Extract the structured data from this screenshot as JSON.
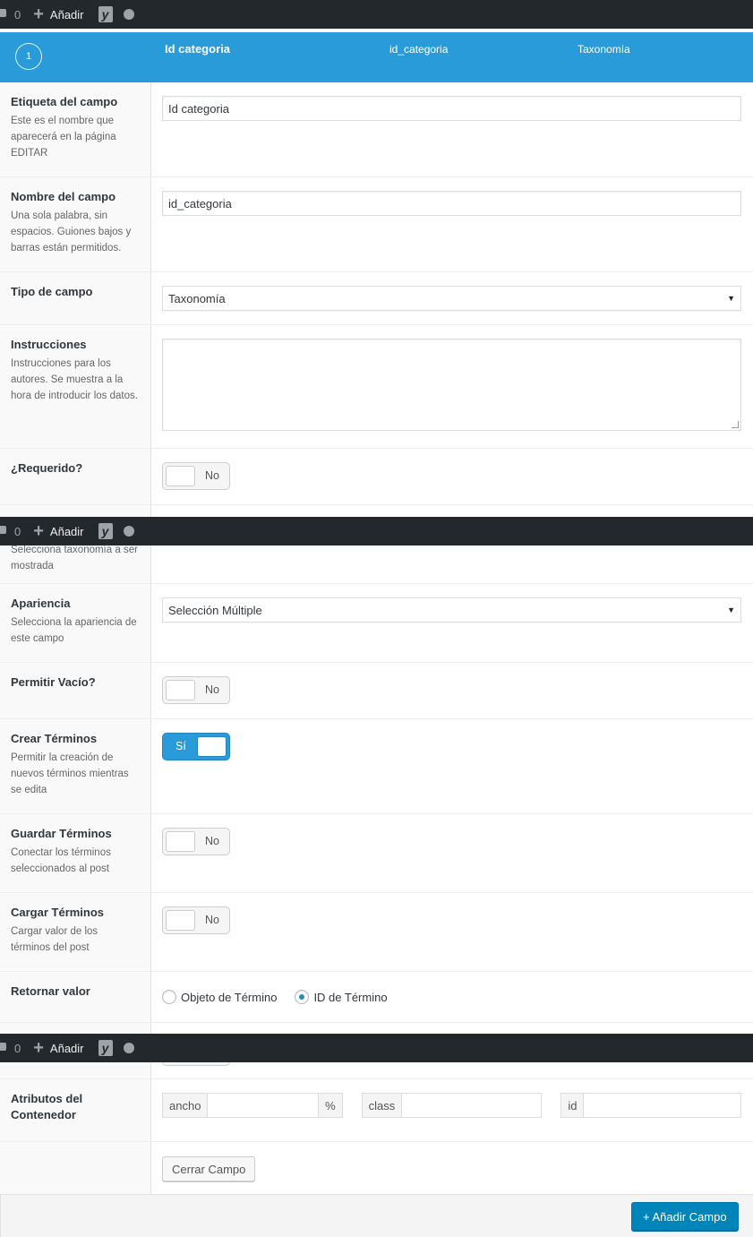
{
  "adminbar": {
    "comment_count": "0",
    "add_label": "Añadir",
    "seo_icon_letter": "y"
  },
  "field_header": {
    "order": "1",
    "label": "Id categoria",
    "name": "id_categoria",
    "type": "Taxonomía"
  },
  "fields": {
    "label": {
      "title": "Etiqueta del campo",
      "desc": "Este es el nombre que aparecerá en la página EDITAR",
      "value": "Id categoria"
    },
    "name": {
      "title": "Nombre del campo",
      "desc": "Una sola palabra, sin espacios. Guiones bajos y barras están permitidos.",
      "value": "id_categoria"
    },
    "type": {
      "title": "Tipo de campo",
      "value": "Taxonomía"
    },
    "instructions": {
      "title": "Instrucciones",
      "desc": "Instrucciones para los autores. Se muestra a la hora de introducir los datos.",
      "value": ""
    },
    "required": {
      "title": "¿Requerido?",
      "state": "No"
    },
    "taxonomy": {
      "desc": "Selecciona taxonomía a ser mostrada"
    },
    "appearance": {
      "title": "Apariencia",
      "desc": "Selecciona la apariencia de este campo",
      "value": "Selección Múltiple"
    },
    "allow_null": {
      "title": "Permitir Vacío?",
      "state": "No"
    },
    "create_terms": {
      "title": "Crear Términos",
      "desc": "Permitir la creación de nuevos términos mientras se edita",
      "state": "Sí"
    },
    "save_terms": {
      "title": "Guardar Términos",
      "desc": "Conectar los términos seleccionados al post",
      "state": "No"
    },
    "load_terms": {
      "title": "Cargar Términos",
      "desc": "Cargar valor de los términos del post",
      "state": "No"
    },
    "return_value": {
      "title": "Retornar valor",
      "options": [
        "Objeto de Término",
        "ID de Término"
      ],
      "selected": "ID de Término"
    },
    "wrapper": {
      "title": "Atributos del Contenedor",
      "width_label": "ancho",
      "width_unit": "%",
      "class_label": "class",
      "id_label": "id"
    }
  },
  "buttons": {
    "close_field": "Cerrar Campo",
    "add_field": "+ Añadir Campo"
  }
}
